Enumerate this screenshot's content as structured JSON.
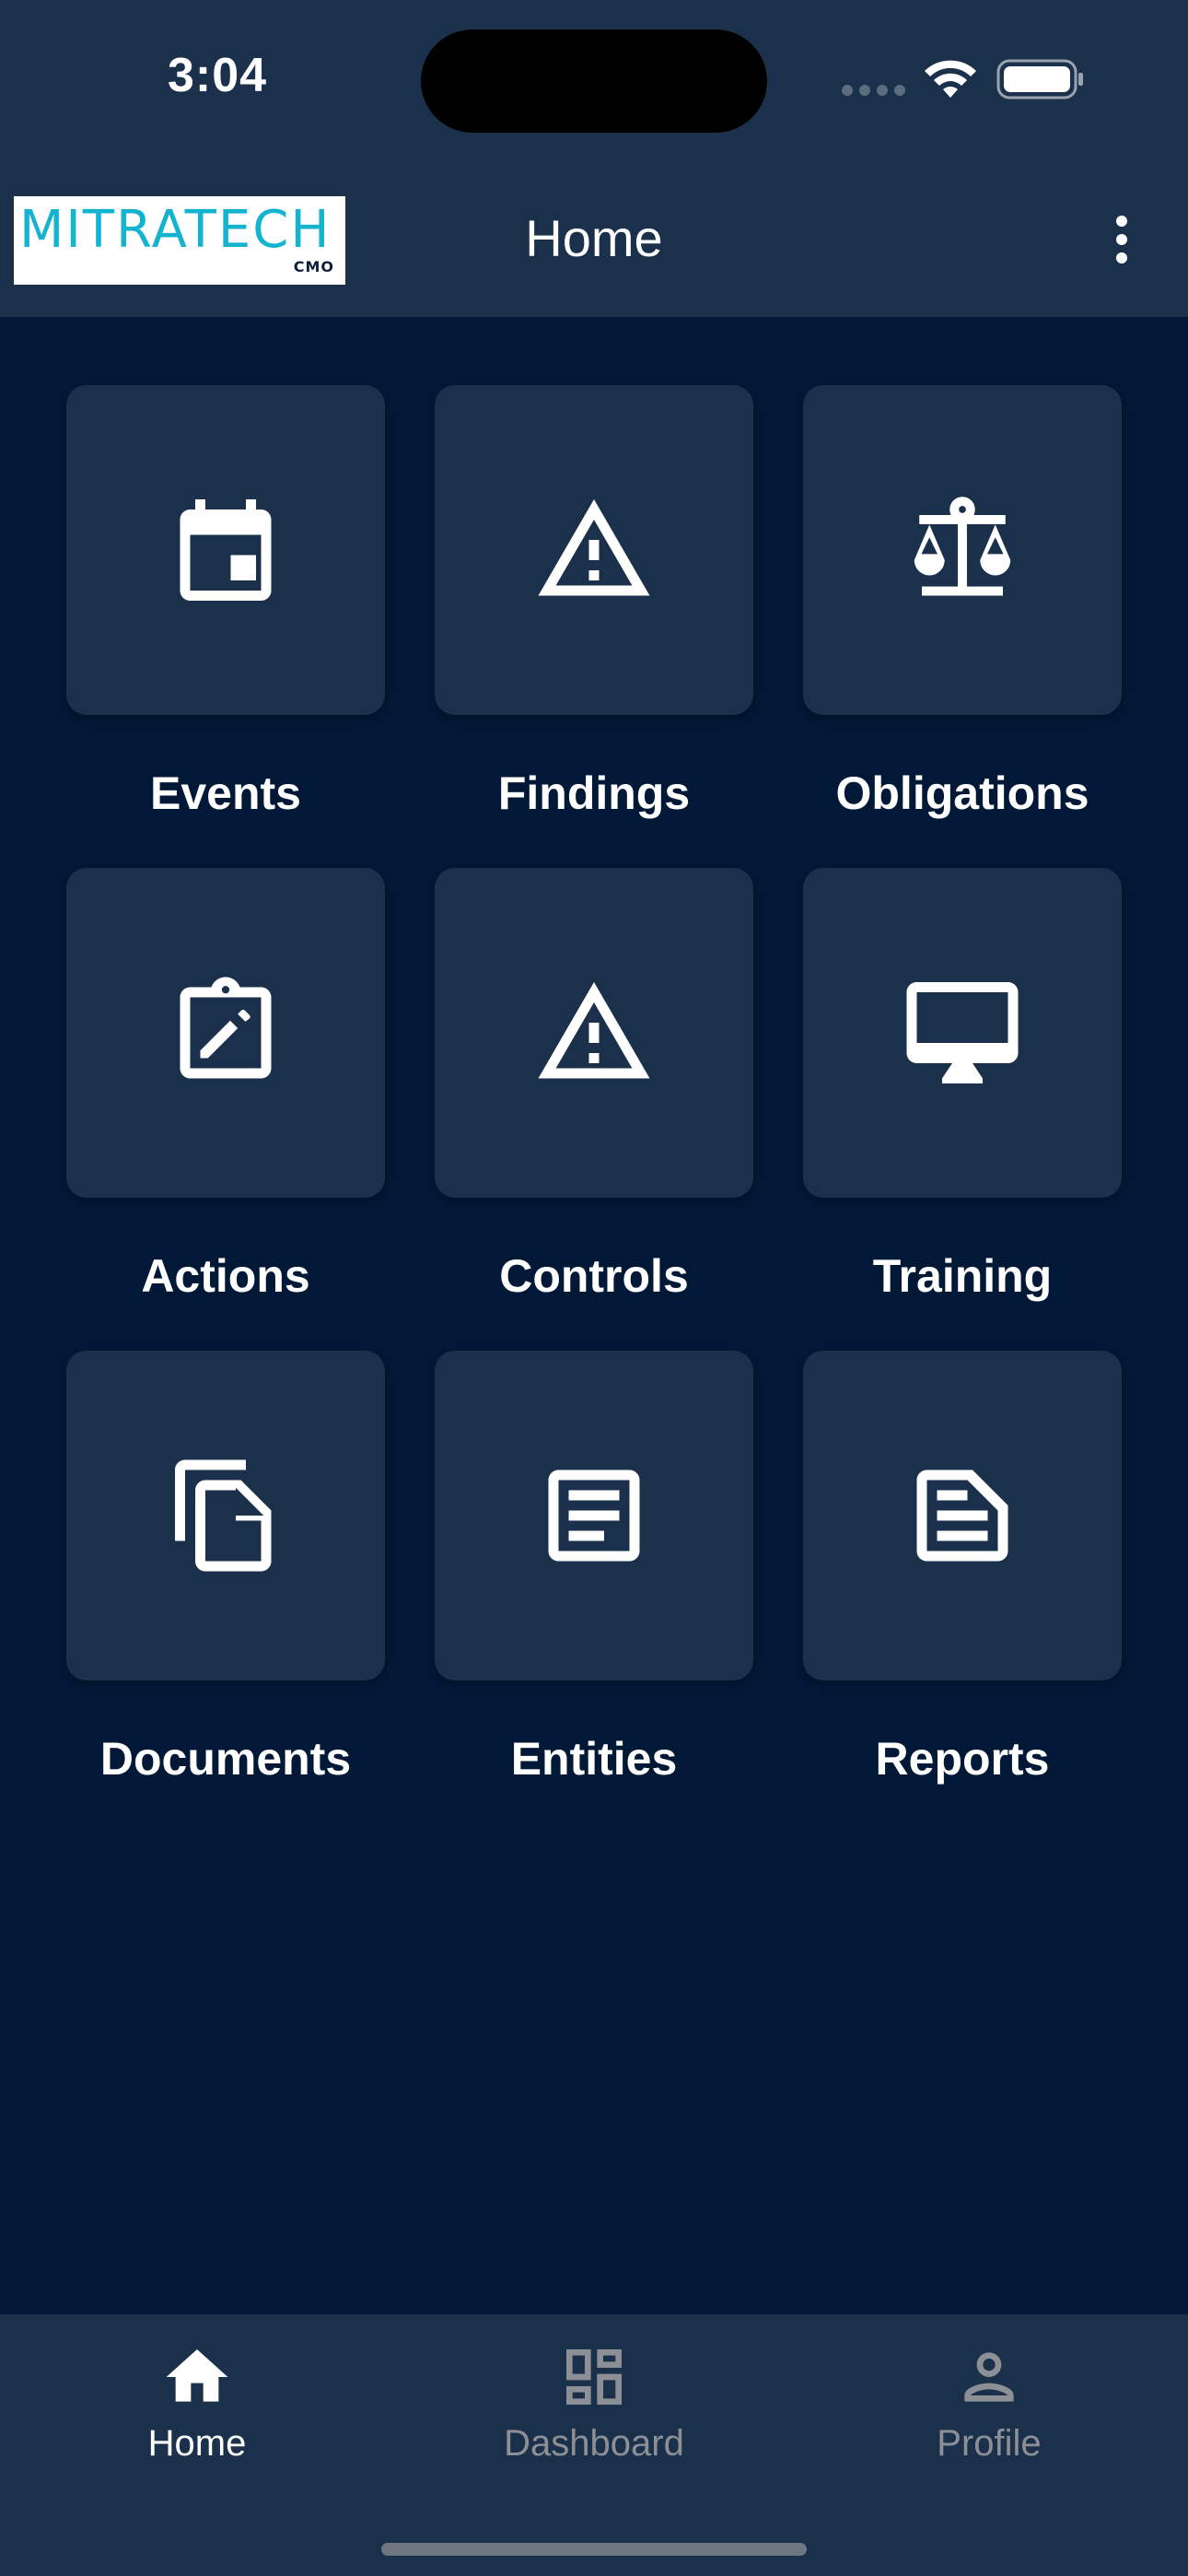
{
  "status_bar": {
    "time": "3:04"
  },
  "header": {
    "logo_text": "MITRATECH",
    "logo_subtext": "CMO",
    "title": "Home",
    "menu_icon": "more-vertical-icon"
  },
  "tiles": [
    {
      "label": "Events",
      "icon": "calendar-icon"
    },
    {
      "label": "Findings",
      "icon": "warning-icon"
    },
    {
      "label": "Obligations",
      "icon": "scale-icon"
    },
    {
      "label": "Actions",
      "icon": "clipboard-edit-icon"
    },
    {
      "label": "Controls",
      "icon": "warning-icon"
    },
    {
      "label": "Training",
      "icon": "monitor-icon"
    },
    {
      "label": "Documents",
      "icon": "documents-copy-icon"
    },
    {
      "label": "Entities",
      "icon": "article-icon"
    },
    {
      "label": "Reports",
      "icon": "report-document-icon"
    }
  ],
  "bottom_nav": {
    "items": [
      {
        "label": "Home",
        "icon": "home-icon",
        "active": true
      },
      {
        "label": "Dashboard",
        "icon": "dashboard-icon",
        "active": false
      },
      {
        "label": "Profile",
        "icon": "person-icon",
        "active": false
      }
    ]
  },
  "colors": {
    "background": "#011936",
    "surface": "#1b314b",
    "logo_accent": "#14b3cf",
    "inactive_nav": "#8c8f95"
  }
}
